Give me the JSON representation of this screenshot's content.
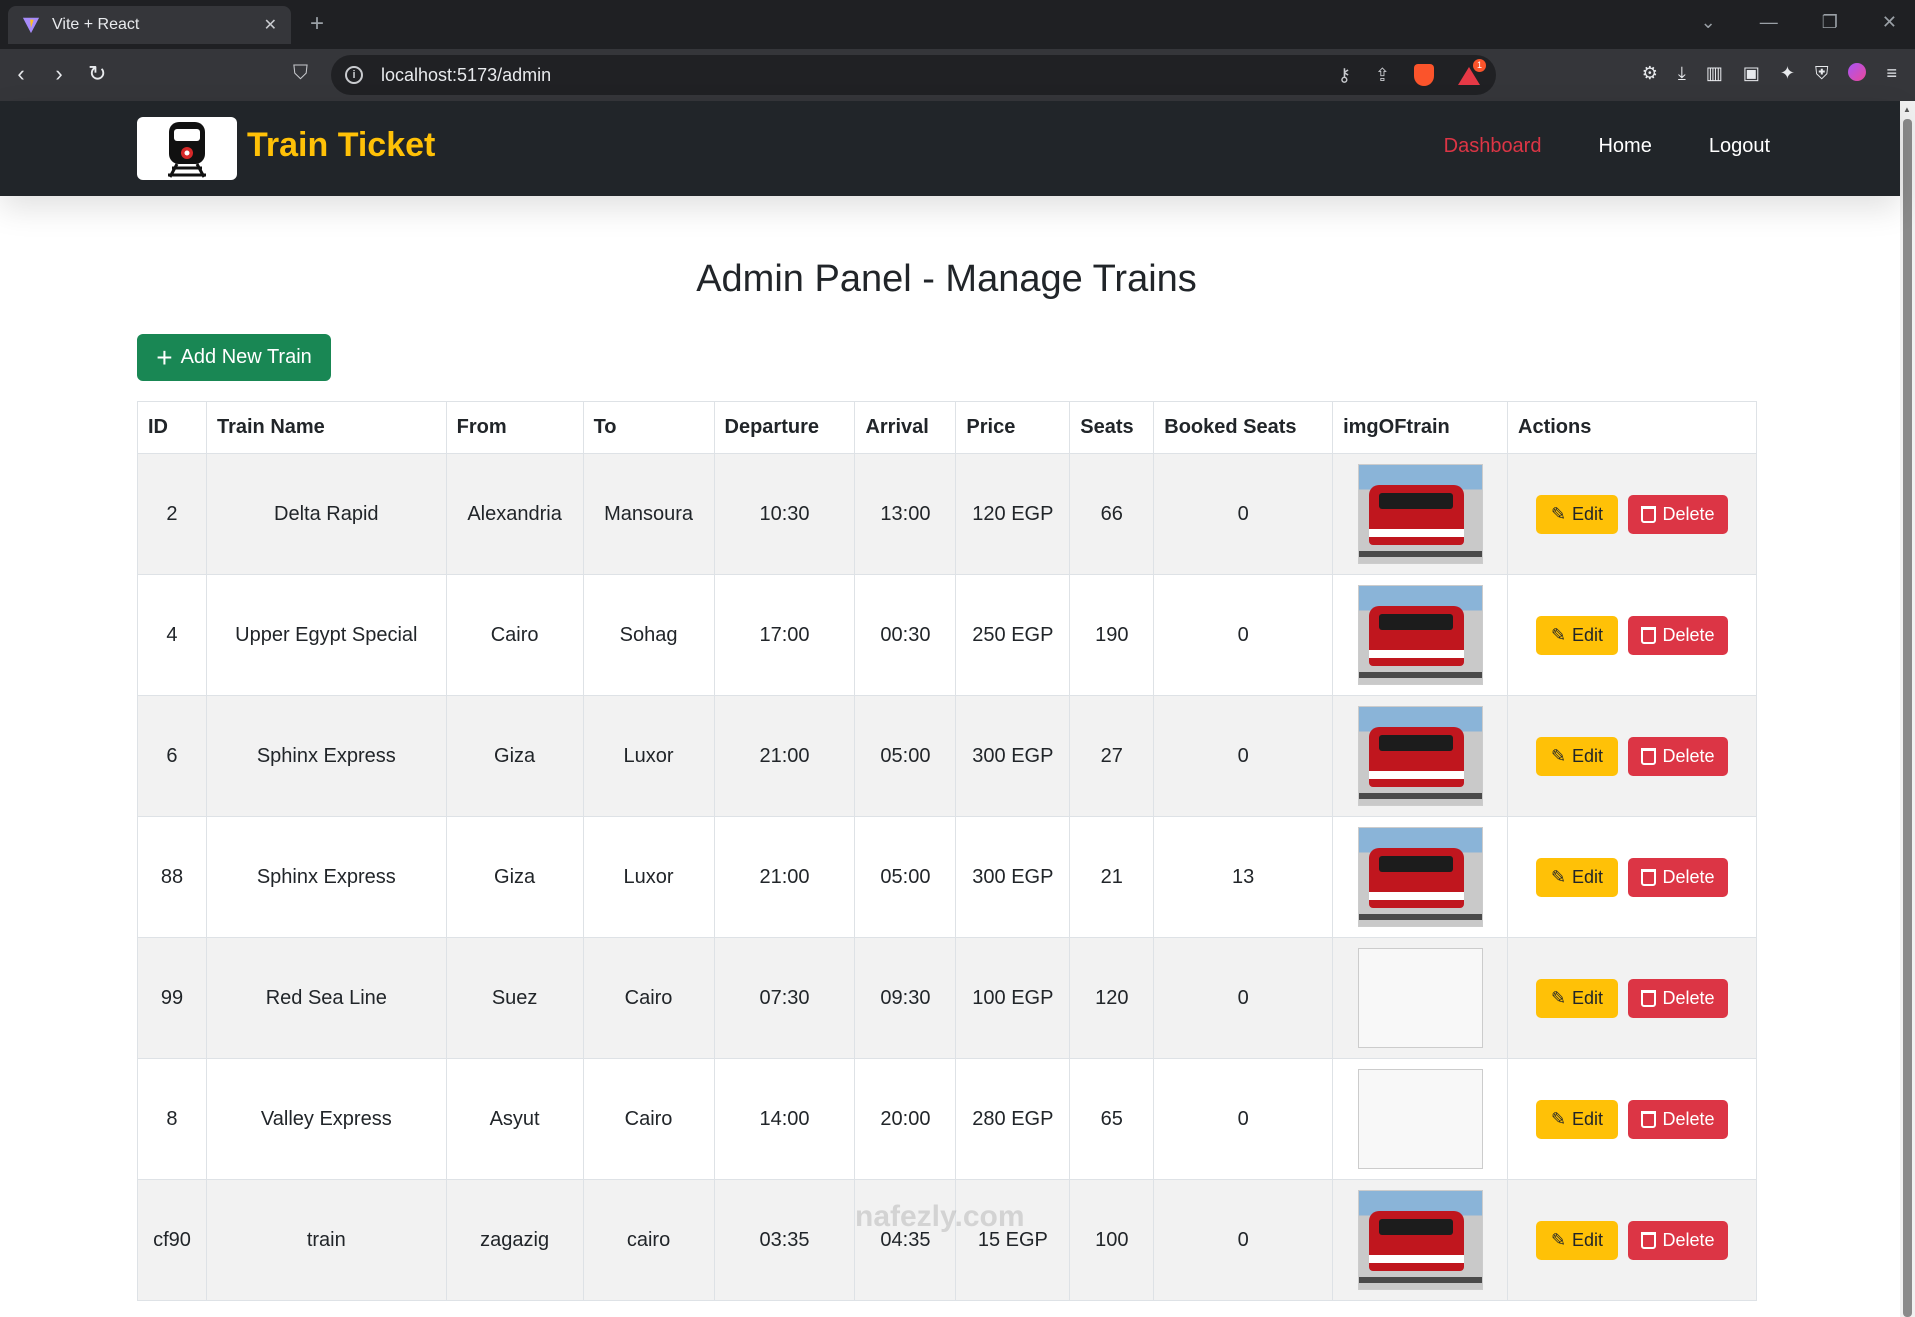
{
  "browser": {
    "tab_title": "Vite + React",
    "url": "localhost:5173/admin"
  },
  "navbar": {
    "brand": "Train Ticket",
    "links": [
      {
        "label": "Dashboard",
        "active": true
      },
      {
        "label": "Home",
        "active": false
      },
      {
        "label": "Logout",
        "active": false
      }
    ]
  },
  "page": {
    "title": "Admin Panel - Manage Trains",
    "add_button": "Add New Train"
  },
  "table": {
    "columns": [
      "ID",
      "Train Name",
      "From",
      "To",
      "Departure",
      "Arrival",
      "Price",
      "Seats",
      "Booked Seats",
      "imgOFtrain",
      "Actions"
    ],
    "rows": [
      {
        "id": "2",
        "name": "Delta Rapid",
        "from": "Alexandria",
        "to": "Mansoura",
        "departure": "10:30",
        "arrival": "13:00",
        "price": "120 EGP",
        "seats": "66",
        "booked": "0",
        "image": "train"
      },
      {
        "id": "4",
        "name": "Upper Egypt Special",
        "from": "Cairo",
        "to": "Sohag",
        "departure": "17:00",
        "arrival": "00:30",
        "price": "250 EGP",
        "seats": "190",
        "booked": "0",
        "image": "train"
      },
      {
        "id": "6",
        "name": "Sphinx Express",
        "from": "Giza",
        "to": "Luxor",
        "departure": "21:00",
        "arrival": "05:00",
        "price": "300 EGP",
        "seats": "27",
        "booked": "0",
        "image": "train"
      },
      {
        "id": "88",
        "name": "Sphinx Express",
        "from": "Giza",
        "to": "Luxor",
        "departure": "21:00",
        "arrival": "05:00",
        "price": "300 EGP",
        "seats": "21",
        "booked": "13",
        "image": "train"
      },
      {
        "id": "99",
        "name": "Red Sea Line",
        "from": "Suez",
        "to": "Cairo",
        "departure": "07:30",
        "arrival": "09:30",
        "price": "100 EGP",
        "seats": "120",
        "booked": "0",
        "image": "empty"
      },
      {
        "id": "8",
        "name": "Valley Express",
        "from": "Asyut",
        "to": "Cairo",
        "departure": "14:00",
        "arrival": "20:00",
        "price": "280 EGP",
        "seats": "65",
        "booked": "0",
        "image": "empty"
      },
      {
        "id": "cf90",
        "name": "train",
        "from": "zagazig",
        "to": "cairo",
        "departure": "03:35",
        "arrival": "04:35",
        "price": "15 EGP",
        "seats": "100",
        "booked": "0",
        "image": "train"
      }
    ],
    "edit_label": "Edit",
    "delete_label": "Delete"
  },
  "watermark": "nafezly.com",
  "colors": {
    "brand": "#ffc107",
    "navbar_bg": "#212529",
    "active_link": "#dc3545",
    "add_button": "#198754",
    "edit_button": "#ffc107",
    "delete_button": "#dc3545"
  }
}
